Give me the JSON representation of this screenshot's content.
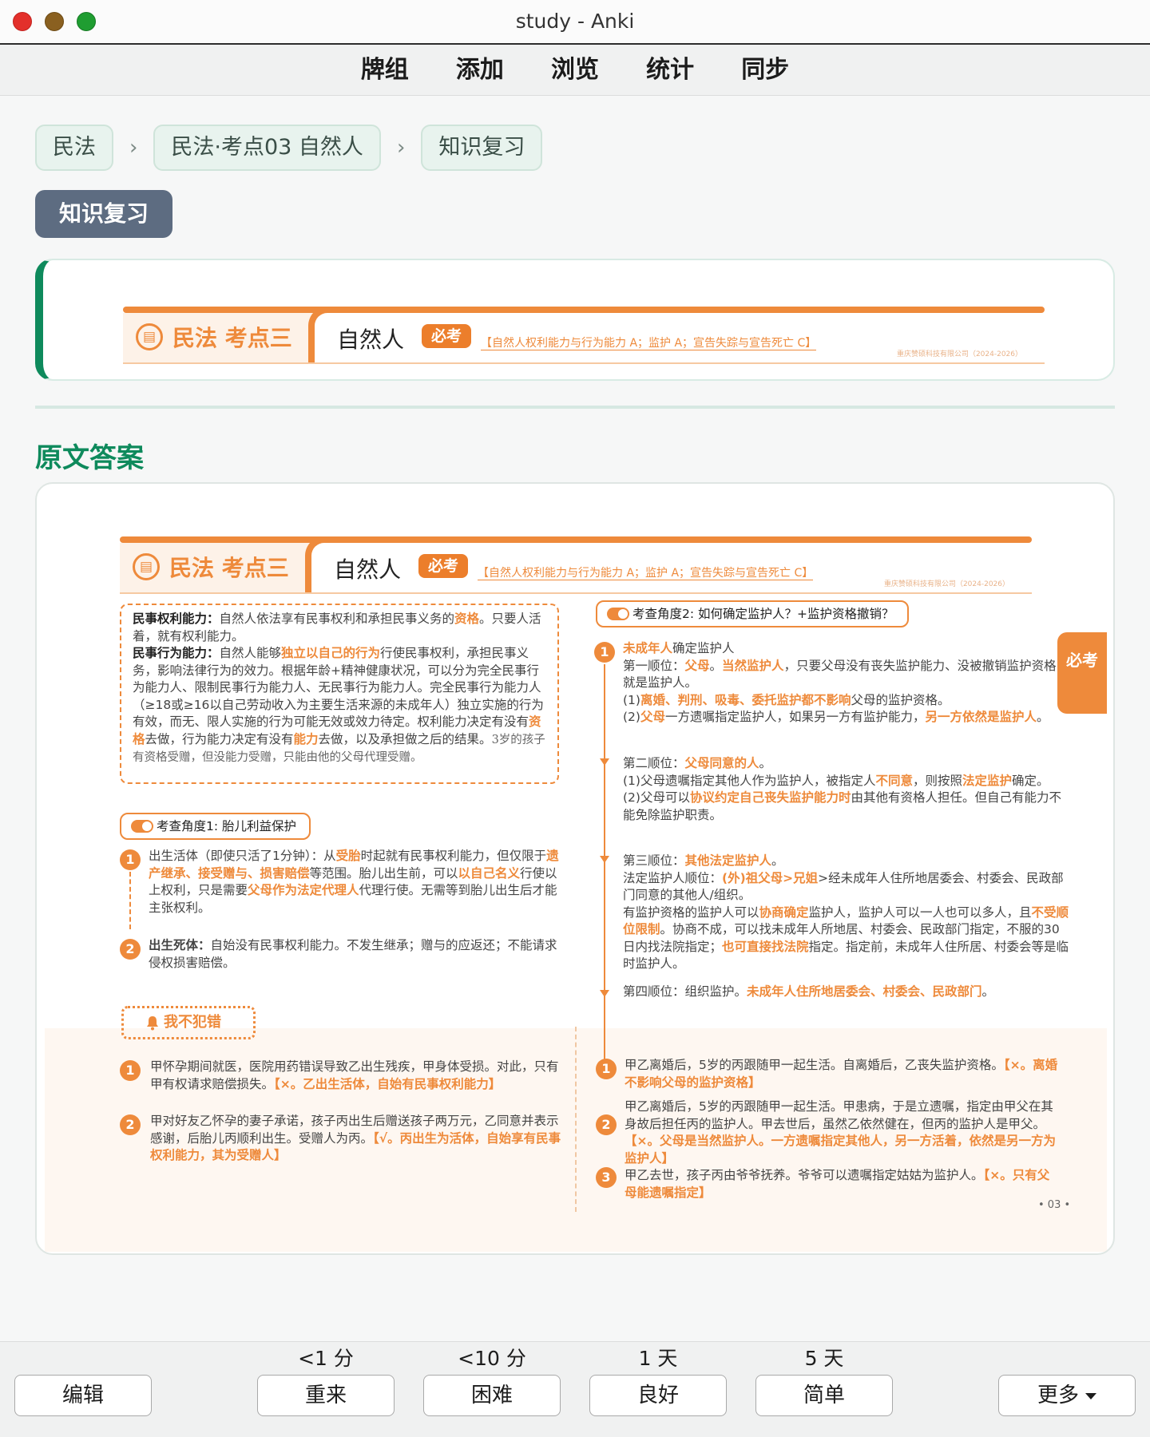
{
  "window": {
    "title": "study - Anki"
  },
  "toolbar": {
    "items": [
      "牌组",
      "添加",
      "浏览",
      "统计",
      "同步"
    ]
  },
  "breadcrumb": [
    "民法",
    "民法·考点03 自然人",
    "知识复习"
  ],
  "section_tag": "知识复习",
  "banner": {
    "subject": "民法 考点三",
    "topic": "自然人",
    "badge": "必考",
    "scope": "【自然人权利能力与行为能力 A；监护 A；宣告失踪与宣告死亡 C】",
    "company": "重庆赞硕科技有限公司（2024-2026）"
  },
  "answer_heading": "原文答案",
  "back": {
    "definitions": {
      "p1_label": "民事权利能力：",
      "p1_a": "自然人依法享有民事权利和承担民事义务的",
      "p1_hl": "资格",
      "p1_b": "。只要人活着，就有权利能力。",
      "p2_label": "民事行为能力：",
      "p2_a": "自然人能够",
      "p2_hl1": "独立以自己的行为",
      "p2_b": "行使民事权利，承担民事义务，影响法律行为的效力。根据年龄+精神健康状况，可以分为完全民事行为能力人、限制民事行为能力人、无民事行为能力人。完全民事行为能力人（≥18或≥16以自己劳动收入为主要生活来源的未成年人）独立实施的行为有效，而无、限人实施的行为可能无效或效力待定。权利能力决定有没有",
      "p2_hl2": "资格",
      "p2_c": "去做，行为能力决定有没有",
      "p2_hl3": "能力",
      "p2_d": "去做，以及承担做之后的结果。",
      "p2_note": "3岁的孩子有资格受赠，但没能力受赠，只能由他的父母代理受赠。"
    },
    "angle1": {
      "label": "考查角度1:  胎儿利益保护",
      "items": [
        {
          "num": "1",
          "a": "出生活体（即使只活了1分钟）：从",
          "hl1": "受胎",
          "b": "时起就有民事权利能力，但仅限于",
          "hl2": "遗产继承、接受赠与、损害赔偿",
          "c": "等范围。胎儿出生前，可以",
          "hl3": "以自己名义",
          "d": "行使以上权利，只是需要",
          "hl4": "父母作为法定代理人",
          "e": "代理行使。无需等到胎儿出生后才能主张权利。"
        },
        {
          "num": "2",
          "label": "出生死体：",
          "a": "自始没有民事权利能力。不发生继承；赠与的应返还；不能请求侵权损害赔偿。"
        }
      ]
    },
    "angle2": {
      "label": "考查角度2:  如何确定监护人？+监护资格撤销？",
      "num": "1",
      "intro_hl": "未成年人",
      "intro": "确定监护人",
      "o1_a": "第一顺位：",
      "o1_hl1": "父母",
      "o1_b": "。",
      "o1_hl2": "当然监护人",
      "o1_c": "，只要父母没有丧失监护能力、没被撤销监护资格，就是监护人。",
      "o1_s1_a": "(1)",
      "o1_s1_hl": "离婚、判刑、吸毒、委托监护都不影响",
      "o1_s1_b": "父母的监护资格。",
      "o1_s2_a": "(2)",
      "o1_s2_hl1": "父母",
      "o1_s2_b": "一方遗嘱指定监护人，如果另一方有监护能力，",
      "o1_s2_hl2": "另一方依然是监护人",
      "o1_s2_c": "。",
      "o2_a": "第二顺位：",
      "o2_hl": "父母同意的人",
      "o2_b": "。",
      "o2_s1_a": "(1)父母遗嘱指定其他人作为监护人，被指定人",
      "o2_s1_hl1": "不同意",
      "o2_s1_b": "，则按照",
      "o2_s1_hl2": "法定监护",
      "o2_s1_c": "确定。",
      "o2_s2_a": "(2)父母可以",
      "o2_s2_hl": "协议约定自己丧失监护能力时",
      "o2_s2_b": "由其他有资格人担任。但自己有能力不能免除监护职责。",
      "o3_a": "第三顺位：",
      "o3_hl": "其他法定监护人",
      "o3_b": "。",
      "o3_l1_a": "法定监护人顺位：",
      "o3_l1_hl": "(外)祖父母>兄姐",
      "o3_l1_b": ">经未成年人住所地居委会、村委会、民政部门同意的其他人/组织。",
      "o3_l2_a": "有监护资格的监护人可以",
      "o3_l2_hl1": "协商确定",
      "o3_l2_b": "监护人，监护人可以一人也可以多人，且",
      "o3_l2_hl2": "不受顺位限制",
      "o3_l2_c": "。协商不成，可以找未成年人所地居、村委会、民政部门指定，不服的30日内找法院指定；",
      "o3_l2_hl3": "也可直接找法院",
      "o3_l2_d": "指定。指定前，未成年人住所居、村委会等是临时监护人。",
      "o4_a": "第四顺位：组织监护。",
      "o4_hl": "未成年人住所地居委会、村委会、民政部门",
      "o4_b": "。"
    },
    "side_tab": "必考",
    "mistakes": {
      "label": "我不犯错",
      "left": [
        {
          "num": "1",
          "text": "甲怀孕期间就医，医院用药错误导致乙出生残疾，甲身体受损。对此，只有甲有权请求赔偿损失。",
          "verdict": "【×。乙出生活体，自始有民事权利能力】"
        },
        {
          "num": "2",
          "text": "甲对好友乙怀孕的妻子承诺，孩子丙出生后赠送孩子两万元，乙同意并表示感谢，后胎儿丙顺利出生。受赠人为丙。",
          "verdict": "【√。丙出生为活体，自始享有民事权利能力，其为受赠人】"
        }
      ],
      "right": [
        {
          "num": "1",
          "text": "甲乙离婚后，5岁的丙跟随甲一起生活。自离婚后，乙丧失监护资格。",
          "verdict": "【×。离婚不影响父母的监护资格】"
        },
        {
          "num": "2",
          "text": "甲乙离婚后，5岁的丙跟随甲一起生活。甲患病，于是立遗嘱，指定由甲父在其身故后担任丙的监护人。甲去世后，虽然乙依然健在，但丙的监护人是甲父。",
          "verdict": "【×。父母是当然监护人。一方遗嘱指定其他人，另一方活着，依然是另一方为监护人】"
        },
        {
          "num": "3",
          "text": "甲乙去世，孩子丙由爷爷抚养。爷爷可以遗嘱指定姑姑为监护人。",
          "verdict": "【×。只有父母能遗嘱指定】"
        }
      ]
    },
    "page_number": "• 03 •"
  },
  "answer_buttons": {
    "edit": "编辑",
    "again_interval": "<1 分",
    "again": "重来",
    "hard_interval": "<10 分",
    "hard": "困难",
    "good_interval": "1 天",
    "good": "良好",
    "easy_interval": "5 天",
    "easy": "简单",
    "more": "更多"
  },
  "colors": {
    "accent_green": "#0e8a5c",
    "accent_orange": "#ee8a3b",
    "tag_slate": "#5d6c81"
  }
}
